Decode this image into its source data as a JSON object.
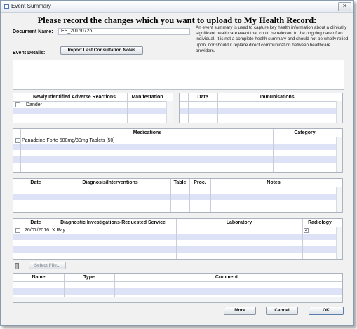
{
  "window": {
    "title": "Event Summary",
    "close_glyph": "✕"
  },
  "heading": "Please record the changes which you want to upload to My Health Record:",
  "document": {
    "label": "Document Name:",
    "value": "ES_20160726"
  },
  "description": "An event summary is used to capture key health information about a clinically significant healthcare event that could be relevant to the ongoing care of an individual. It is not a complete health summary and should not be wholly relied upon, nor should it replace direct communication between healthcare providers.",
  "event_details": {
    "label": "Event Details:",
    "import_button": "Import Last Consultation Notes",
    "value": ""
  },
  "adverse": {
    "headers": [
      "Newly Identified Adverse Reactions",
      "Manifestation"
    ],
    "rows": [
      {
        "checked": false,
        "reaction": "Dander",
        "manifestation": ""
      }
    ]
  },
  "immunisations": {
    "headers": [
      "Date",
      "Immunisations"
    ]
  },
  "medications": {
    "headers": [
      "Medications",
      "Category"
    ],
    "rows": [
      {
        "checked": false,
        "medication": "Panadeine Forte 500mg/30mg Tablets [50]",
        "category": ""
      }
    ]
  },
  "diagnosis": {
    "headers": [
      "Date",
      "Diagnosis/Interventions",
      "Table",
      "Proc.",
      "Notes"
    ]
  },
  "investigations": {
    "headers": [
      "Date",
      "Diagnostic Investigations-Requested Service",
      "Laboratory",
      "Radiology"
    ],
    "rows": [
      {
        "checked": false,
        "date": "26/07/2016",
        "service": "X Ray",
        "laboratory": "",
        "radiology": true
      }
    ]
  },
  "attachments": {
    "select_button": "Select File...",
    "headers": [
      "Name",
      "Type",
      "Comment"
    ]
  },
  "footer": {
    "more": "More",
    "cancel": "Cancel",
    "ok": "OK"
  }
}
